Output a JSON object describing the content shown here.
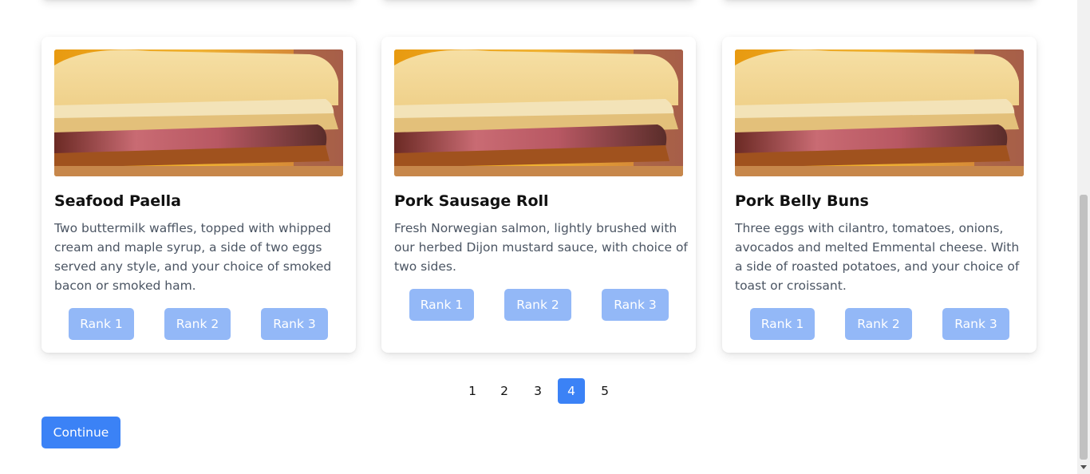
{
  "cards": [
    {
      "title": "Seafood Paella",
      "description": "Two buttermilk waffles, topped with whipped cream and maple syrup, a side of two eggs served any style, and your choice of smoked bacon or smoked ham.",
      "image_alt": "burger-photo",
      "buttons": [
        "Rank 1",
        "Rank 2",
        "Rank 3"
      ]
    },
    {
      "title": "Pork Sausage Roll",
      "description": "Fresh Norwegian salmon, lightly brushed with our herbed Dijon mustard sauce, with choice of two sides.",
      "image_alt": "burger-photo",
      "buttons": [
        "Rank 1",
        "Rank 2",
        "Rank 3"
      ]
    },
    {
      "title": "Pork Belly Buns",
      "description": "Three eggs with cilantro, tomatoes, onions, avocados and melted Emmental cheese. With a side of roasted potatoes, and your choice of toast or croissant.",
      "image_alt": "burger-photo",
      "buttons": [
        "Rank 1",
        "Rank 2",
        "Rank 3"
      ]
    }
  ],
  "pagination": {
    "pages": [
      "1",
      "2",
      "3",
      "4",
      "5"
    ],
    "current": "4"
  },
  "continue_label": "Continue",
  "colors": {
    "primary": "#3b82f6",
    "rank_button": "#93b8f7",
    "description_text": "#4b5563"
  },
  "icons": {
    "scroll_down": "scroll-down-arrow-icon"
  }
}
